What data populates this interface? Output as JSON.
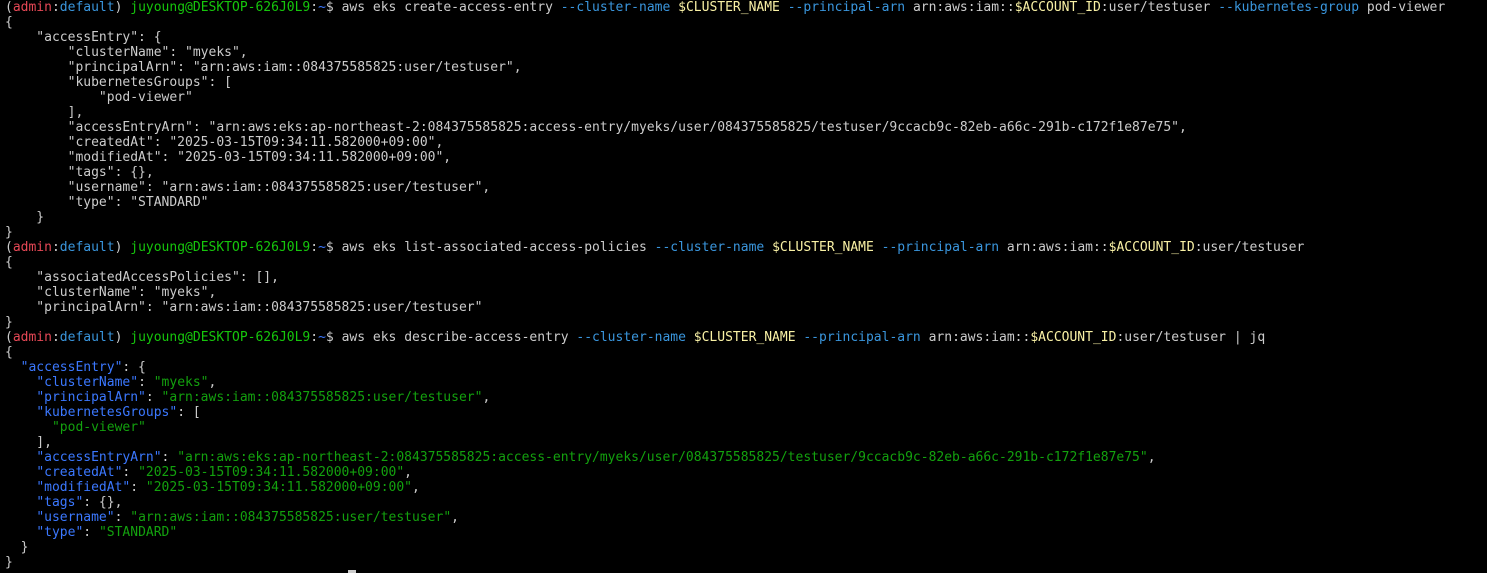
{
  "terminal": {
    "colors": {
      "background": "#000000",
      "default": "#cccccc",
      "red": "#e74856",
      "green": "#16c60c",
      "blue": "#3b78ff",
      "cyan": "#3a96dd",
      "yellow": "#f9f1a5",
      "jq_key": "#3b78ff",
      "jq_string": "#13a10e"
    },
    "lines": [
      [
        [
          "(",
          "default"
        ],
        [
          "admin",
          "red"
        ],
        [
          ":",
          "default"
        ],
        [
          "default",
          "cyan"
        ],
        [
          ") ",
          "default"
        ],
        [
          "juyoung@DESKTOP-626J0L9",
          "green"
        ],
        [
          ":",
          "default"
        ],
        [
          "~",
          "blue"
        ],
        [
          "$ aws eks create-access-entry ",
          "default"
        ],
        [
          "--cluster-name",
          "cyan"
        ],
        [
          " ",
          "default"
        ],
        [
          "$CLUSTER_NAME",
          "yellow"
        ],
        [
          " ",
          "default"
        ],
        [
          "--principal-arn",
          "cyan"
        ],
        [
          " arn:aws:iam::",
          "default"
        ],
        [
          "$ACCOUNT_ID",
          "yellow"
        ],
        [
          ":user/testuser ",
          "default"
        ],
        [
          "--kubernetes-group",
          "cyan"
        ],
        [
          " pod-viewer",
          "default"
        ]
      ],
      [
        [
          "{",
          "default"
        ]
      ],
      [
        [
          "    \"accessEntry\": {",
          "default"
        ]
      ],
      [
        [
          "        \"clusterName\": \"myeks\",",
          "default"
        ]
      ],
      [
        [
          "        \"principalArn\": \"arn:aws:iam::084375585825:user/testuser\",",
          "default"
        ]
      ],
      [
        [
          "        \"kubernetesGroups\": [",
          "default"
        ]
      ],
      [
        [
          "            \"pod-viewer\"",
          "default"
        ]
      ],
      [
        [
          "        ],",
          "default"
        ]
      ],
      [
        [
          "        \"accessEntryArn\": \"arn:aws:eks:ap-northeast-2:084375585825:access-entry/myeks/user/084375585825/testuser/9ccacb9c-82eb-a66c-291b-c172f1e87e75\",",
          "default"
        ]
      ],
      [
        [
          "        \"createdAt\": \"2025-03-15T09:34:11.582000+09:00\",",
          "default"
        ]
      ],
      [
        [
          "        \"modifiedAt\": \"2025-03-15T09:34:11.582000+09:00\",",
          "default"
        ]
      ],
      [
        [
          "        \"tags\": {},",
          "default"
        ]
      ],
      [
        [
          "        \"username\": \"arn:aws:iam::084375585825:user/testuser\",",
          "default"
        ]
      ],
      [
        [
          "        \"type\": \"STANDARD\"",
          "default"
        ]
      ],
      [
        [
          "    }",
          "default"
        ]
      ],
      [
        [
          "}",
          "default"
        ]
      ],
      [
        [
          "(",
          "default"
        ],
        [
          "admin",
          "red"
        ],
        [
          ":",
          "default"
        ],
        [
          "default",
          "cyan"
        ],
        [
          ") ",
          "default"
        ],
        [
          "juyoung@DESKTOP-626J0L9",
          "green"
        ],
        [
          ":",
          "default"
        ],
        [
          "~",
          "blue"
        ],
        [
          "$ aws eks list-associated-access-policies ",
          "default"
        ],
        [
          "--cluster-name",
          "cyan"
        ],
        [
          " ",
          "default"
        ],
        [
          "$CLUSTER_NAME",
          "yellow"
        ],
        [
          " ",
          "default"
        ],
        [
          "--principal-arn",
          "cyan"
        ],
        [
          " arn:aws:iam::",
          "default"
        ],
        [
          "$ACCOUNT_ID",
          "yellow"
        ],
        [
          ":user/testuser",
          "default"
        ]
      ],
      [
        [
          "{",
          "default"
        ]
      ],
      [
        [
          "    \"associatedAccessPolicies\": [],",
          "default"
        ]
      ],
      [
        [
          "    \"clusterName\": \"myeks\",",
          "default"
        ]
      ],
      [
        [
          "    \"principalArn\": \"arn:aws:iam::084375585825:user/testuser\"",
          "default"
        ]
      ],
      [
        [
          "}",
          "default"
        ]
      ],
      [
        [
          "(",
          "default"
        ],
        [
          "admin",
          "red"
        ],
        [
          ":",
          "default"
        ],
        [
          "default",
          "cyan"
        ],
        [
          ") ",
          "default"
        ],
        [
          "juyoung@DESKTOP-626J0L9",
          "green"
        ],
        [
          ":",
          "default"
        ],
        [
          "~",
          "blue"
        ],
        [
          "$ aws eks describe-access-entry ",
          "default"
        ],
        [
          "--cluster-name",
          "cyan"
        ],
        [
          " ",
          "default"
        ],
        [
          "$CLUSTER_NAME",
          "yellow"
        ],
        [
          " ",
          "default"
        ],
        [
          "--principal-arn",
          "cyan"
        ],
        [
          " arn:aws:iam::",
          "default"
        ],
        [
          "$ACCOUNT_ID",
          "yellow"
        ],
        [
          ":user/testuser | jq",
          "default"
        ]
      ],
      [
        [
          "{",
          "default"
        ]
      ],
      [
        [
          "  ",
          "default"
        ],
        [
          "\"accessEntry\"",
          "jq_key"
        ],
        [
          ": {",
          "default"
        ]
      ],
      [
        [
          "    ",
          "default"
        ],
        [
          "\"clusterName\"",
          "jq_key"
        ],
        [
          ": ",
          "default"
        ],
        [
          "\"myeks\"",
          "jq_string"
        ],
        [
          ",",
          "default"
        ]
      ],
      [
        [
          "    ",
          "default"
        ],
        [
          "\"principalArn\"",
          "jq_key"
        ],
        [
          ": ",
          "default"
        ],
        [
          "\"arn:aws:iam::084375585825:user/testuser\"",
          "jq_string"
        ],
        [
          ",",
          "default"
        ]
      ],
      [
        [
          "    ",
          "default"
        ],
        [
          "\"kubernetesGroups\"",
          "jq_key"
        ],
        [
          ": [",
          "default"
        ]
      ],
      [
        [
          "      ",
          "default"
        ],
        [
          "\"pod-viewer\"",
          "jq_string"
        ]
      ],
      [
        [
          "    ],",
          "default"
        ]
      ],
      [
        [
          "    ",
          "default"
        ],
        [
          "\"accessEntryArn\"",
          "jq_key"
        ],
        [
          ": ",
          "default"
        ],
        [
          "\"arn:aws:eks:ap-northeast-2:084375585825:access-entry/myeks/user/084375585825/testuser/9ccacb9c-82eb-a66c-291b-c172f1e87e75\"",
          "jq_string"
        ],
        [
          ",",
          "default"
        ]
      ],
      [
        [
          "    ",
          "default"
        ],
        [
          "\"createdAt\"",
          "jq_key"
        ],
        [
          ": ",
          "default"
        ],
        [
          "\"2025-03-15T09:34:11.582000+09:00\"",
          "jq_string"
        ],
        [
          ",",
          "default"
        ]
      ],
      [
        [
          "    ",
          "default"
        ],
        [
          "\"modifiedAt\"",
          "jq_key"
        ],
        [
          ": ",
          "default"
        ],
        [
          "\"2025-03-15T09:34:11.582000+09:00\"",
          "jq_string"
        ],
        [
          ",",
          "default"
        ]
      ],
      [
        [
          "    ",
          "default"
        ],
        [
          "\"tags\"",
          "jq_key"
        ],
        [
          ": {},",
          "default"
        ]
      ],
      [
        [
          "    ",
          "default"
        ],
        [
          "\"username\"",
          "jq_key"
        ],
        [
          ": ",
          "default"
        ],
        [
          "\"arn:aws:iam::084375585825:user/testuser\"",
          "jq_string"
        ],
        [
          ",",
          "default"
        ]
      ],
      [
        [
          "    ",
          "default"
        ],
        [
          "\"type\"",
          "jq_key"
        ],
        [
          ": ",
          "default"
        ],
        [
          "\"STANDARD\"",
          "jq_string"
        ]
      ],
      [
        [
          "  }",
          "default"
        ]
      ],
      [
        [
          "}",
          "default"
        ]
      ]
    ]
  }
}
